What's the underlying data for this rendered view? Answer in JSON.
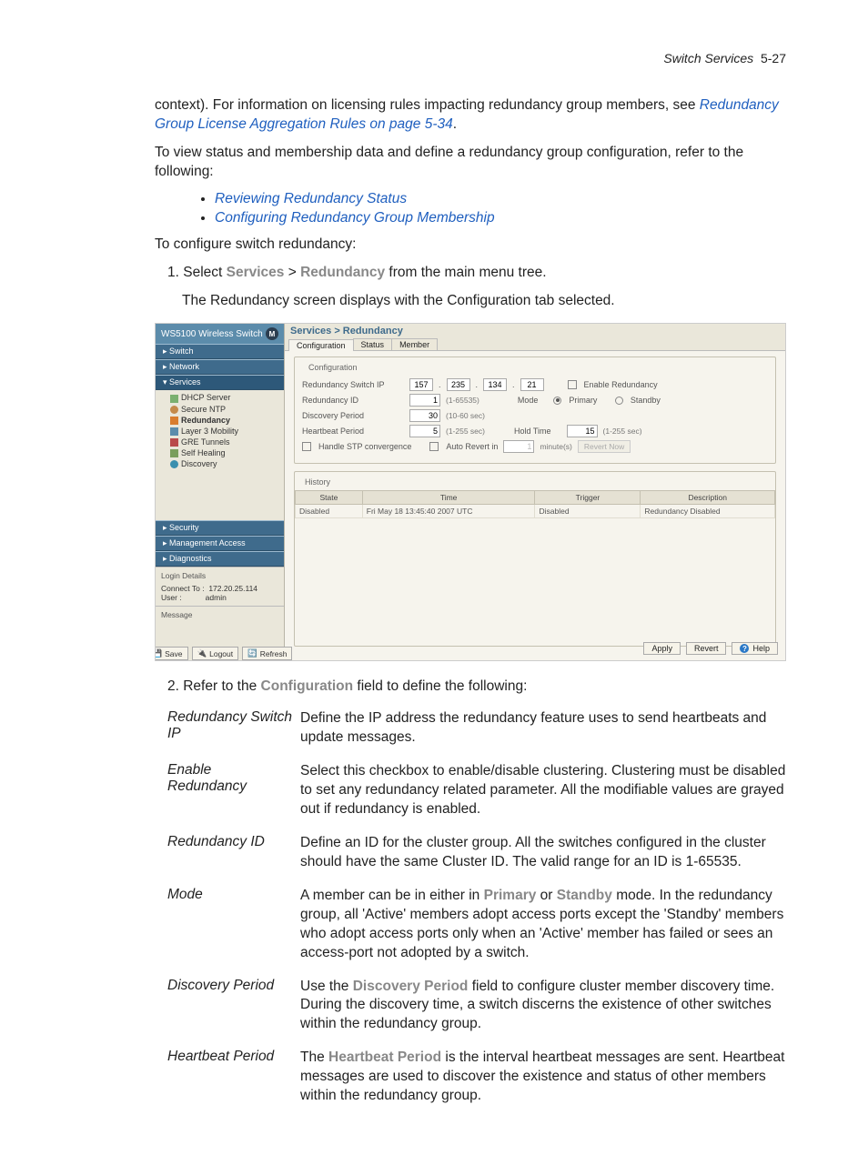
{
  "header": {
    "chapter": "Switch Services",
    "page": "5-27"
  },
  "p_cont_prefix": "context). For information on licensing rules impacting redundancy group members, see ",
  "link_agg": "Redundancy Group License Aggregation Rules on page 5-34",
  "period": ".",
  "p_view": "To view status and membership data and define a redundancy group configuration, refer to the following:",
  "bullets": [
    "Reviewing Redundancy Status",
    "Configuring Redundancy Group Membership"
  ],
  "p_conf": "To configure switch redundancy:",
  "step1_prefix": "1. Select ",
  "step1_services": "Services",
  "step1_gt": " > ",
  "step1_red": "Redundancy",
  "step1_suffix": " from the main menu tree.",
  "step1_sub": "The Redundancy screen displays with the Configuration tab selected.",
  "shot": {
    "app_title": "WS5100 Wireless Switch",
    "nav": {
      "switch": "Switch",
      "network": "Network",
      "services": "Services",
      "services_items": [
        "DHCP Server",
        "Secure NTP",
        "Redundancy",
        "Layer 3 Mobility",
        "GRE Tunnels",
        "Self Healing",
        "Discovery"
      ],
      "security": "Security",
      "mgmt": "Management Access",
      "diag": "Diagnostics"
    },
    "login": {
      "title": "Login Details",
      "connect_lbl": "Connect To :",
      "connect_val": "172.20.25.114",
      "user_lbl": "User :",
      "user_val": "admin",
      "msg_lbl": "Message"
    },
    "side_buttons": {
      "save": "Save",
      "logout": "Logout",
      "refresh": "Refresh"
    },
    "crumb": "Services > Redundancy",
    "tabs": [
      "Configuration",
      "Status",
      "Member"
    ],
    "panel": {
      "legend_conf": "Configuration",
      "ip_label": "Redundancy Switch IP",
      "ip": [
        "157",
        "235",
        "134",
        "21"
      ],
      "enable_label": "Enable Redundancy",
      "id_label": "Redundancy ID",
      "id_value": "1",
      "id_range": "(1-65535)",
      "mode_label": "Mode",
      "mode_primary": "Primary",
      "mode_standby": "Standby",
      "disc_label": "Discovery Period",
      "disc_value": "30",
      "disc_range": "(10-60 sec)",
      "hb_label": "Heartbeat Period",
      "hb_value": "5",
      "hb_range": "(1-255 sec)",
      "hold_label": "Hold Time",
      "hold_value": "15",
      "hold_range": "(1-255 sec)",
      "stp_label": "Handle STP convergence",
      "auto_label": "Auto Revert in",
      "auto_value": "1",
      "auto_unit": "minute(s)",
      "revert_btn": "Revert Now",
      "legend_hist": "History",
      "hist_cols": [
        "State",
        "Time",
        "Trigger",
        "Description"
      ],
      "hist_row": [
        "Disabled",
        "Fri May 18 13:45:40 2007 UTC",
        "Disabled",
        "Redundancy Disabled"
      ]
    },
    "actions": {
      "apply": "Apply",
      "revert": "Revert",
      "help": "Help"
    }
  },
  "step2_prefix": "2. Refer to the ",
  "step2_bold": "Configuration",
  "step2_suffix": " field to define the following:",
  "defs": {
    "rsip_t": "Redundancy Switch IP",
    "rsip_d": "Define the IP address the redundancy feature uses to send heartbeats and update messages.",
    "enr_t": "Enable Redundancy",
    "enr_d": "Select this checkbox to enable/disable clustering. Clustering must be disabled to set any redundancy related parameter. All the modifiable values are grayed out if redundancy is enabled.",
    "rid_t": "Redundancy ID",
    "rid_d": "Define an ID for the cluster group. All the switches configured in the cluster should have the same Cluster ID. The valid range for an ID is 1-65535.",
    "mode_t": "Mode",
    "mode_pre": "A member can be in either in ",
    "mode_p": "Primary",
    "mode_or": " or ",
    "mode_s": "Standby",
    "mode_post": " mode. In the redundancy group, all 'Active' members adopt access ports except the 'Standby' members who adopt access ports only when an 'Active' member has failed or sees an access-port not adopted by a switch.",
    "disc_t": "Discovery Period",
    "disc_pre": "Use the ",
    "disc_b": "Discovery Period",
    "disc_post": " field to configure cluster member discovery time. During the discovery time, a switch discerns the existence of other switches within the redundancy group.",
    "hb_t": "Heartbeat Period",
    "hb_pre": "The ",
    "hb_b": "Heartbeat Period",
    "hb_post": " is the interval heartbeat messages are sent. Heartbeat messages are used to discover the existence and status of other members within the redundancy group."
  }
}
